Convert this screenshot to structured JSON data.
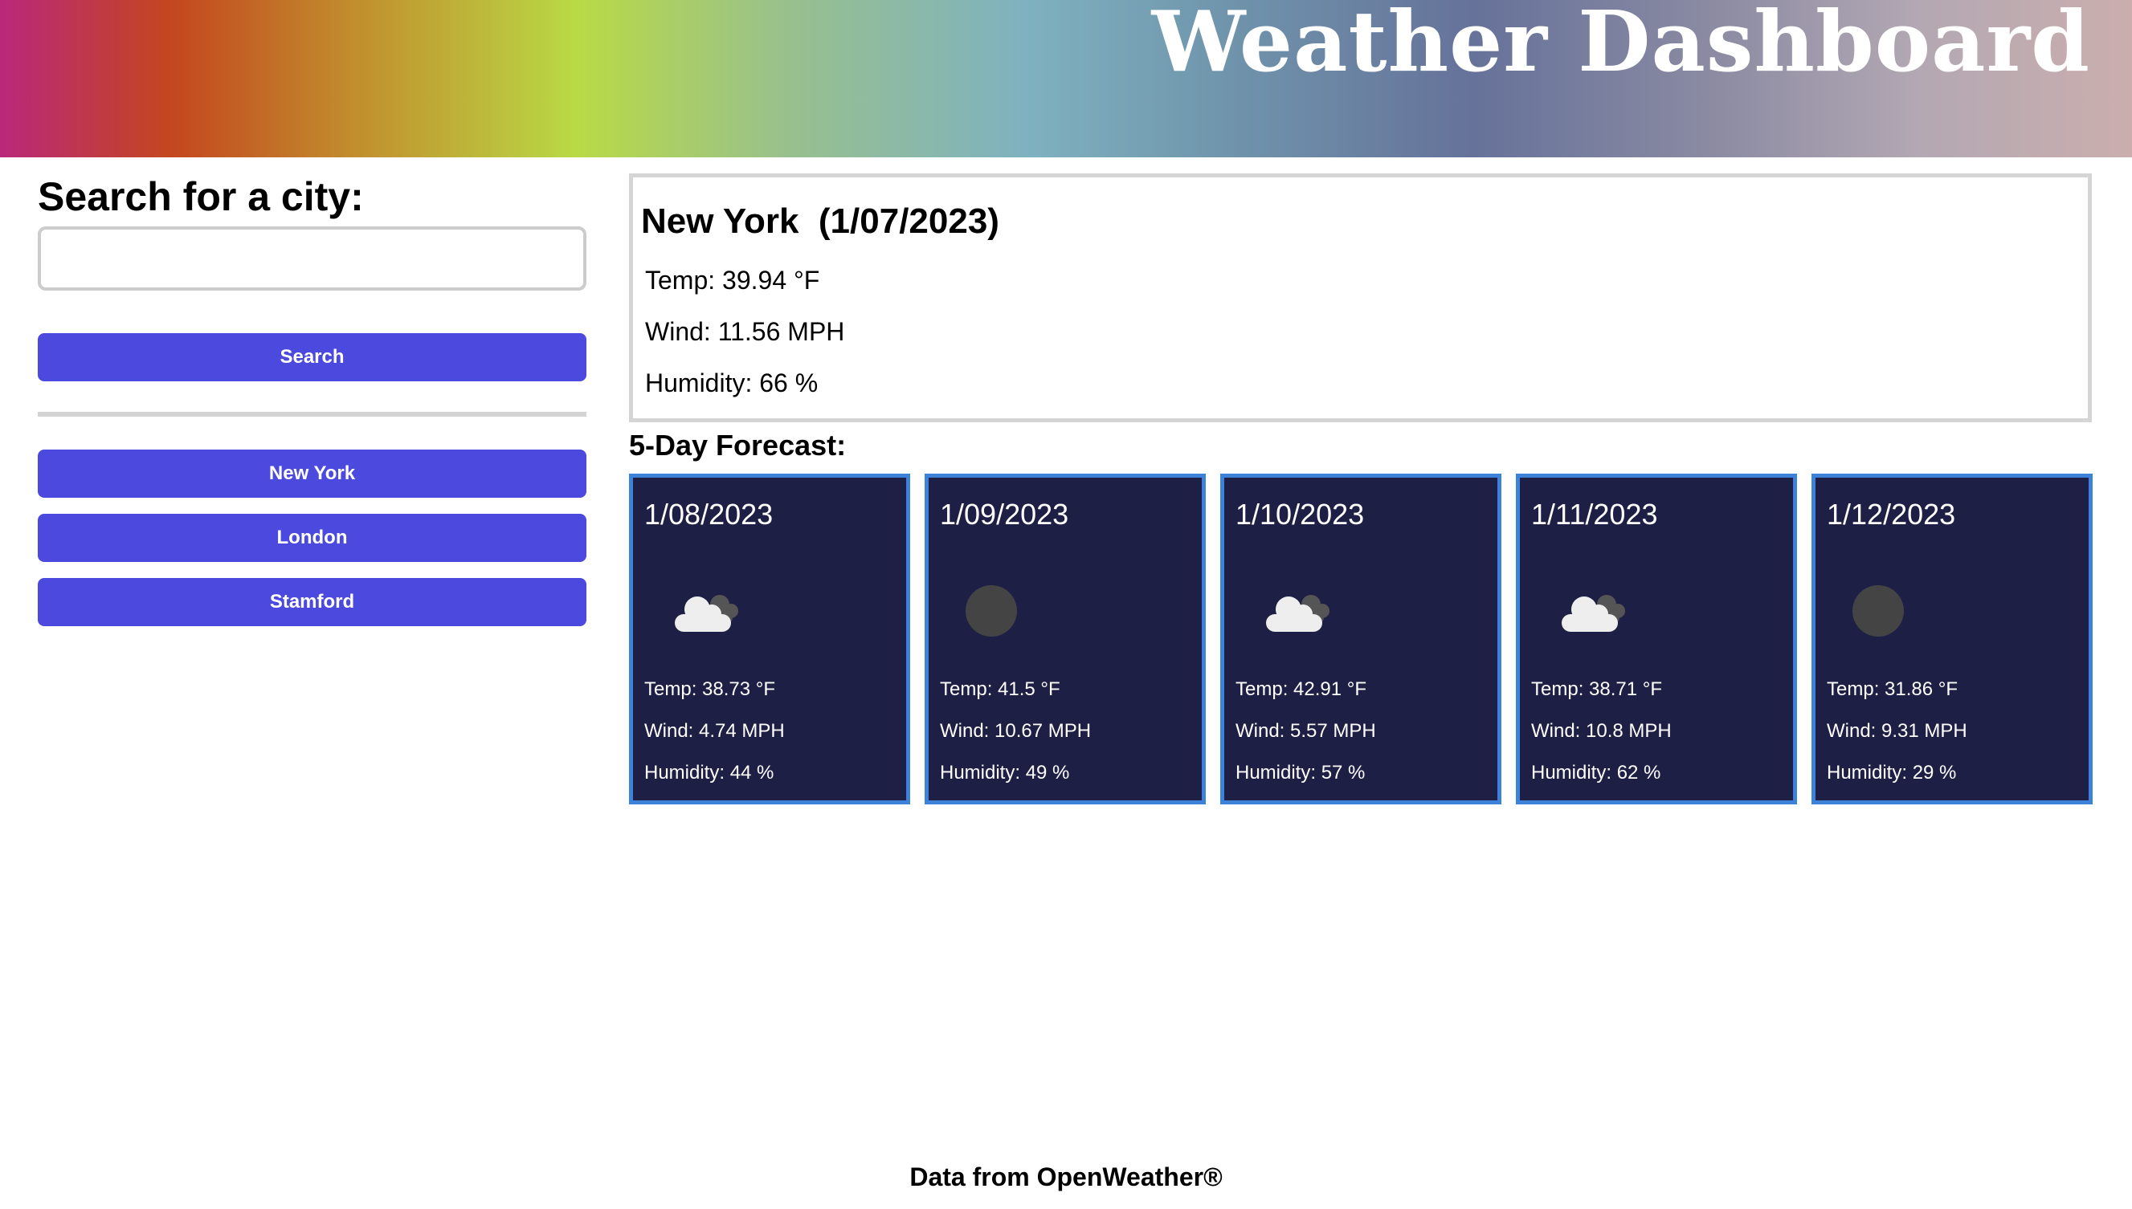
{
  "header": {
    "title": "Weather Dashboard"
  },
  "search": {
    "heading": "Search for a city:",
    "input_value": "",
    "button_label": "Search"
  },
  "history": [
    {
      "label": "New York"
    },
    {
      "label": "London"
    },
    {
      "label": "Stamford"
    }
  ],
  "current": {
    "city": "New York",
    "date": "(1/07/2023)",
    "temp": "Temp: 39.94 °F",
    "wind": "Wind: 11.56 MPH",
    "humidity": "Humidity: 66 %"
  },
  "forecast_title": "5-Day Forecast:",
  "forecast": [
    {
      "date": "1/08/2023",
      "icon": "cloud-icon",
      "temp": "Temp: 38.73 °F",
      "wind": "Wind: 4.74 MPH",
      "humidity": "Humidity: 44 %"
    },
    {
      "date": "1/09/2023",
      "icon": "moon-icon",
      "temp": "Temp: 41.5 °F",
      "wind": "Wind: 10.67 MPH",
      "humidity": "Humidity: 49 %"
    },
    {
      "date": "1/10/2023",
      "icon": "cloud-icon",
      "temp": "Temp: 42.91 °F",
      "wind": "Wind: 5.57 MPH",
      "humidity": "Humidity: 57 %"
    },
    {
      "date": "1/11/2023",
      "icon": "cloud-icon",
      "temp": "Temp: 38.71 °F",
      "wind": "Wind: 10.8 MPH",
      "humidity": "Humidity: 62 %"
    },
    {
      "date": "1/12/2023",
      "icon": "moon-icon",
      "temp": "Temp: 31.86 °F",
      "wind": "Wind: 9.31 MPH",
      "humidity": "Humidity: 29 %"
    }
  ],
  "footer": {
    "text": "Data from OpenWeather®"
  },
  "colors": {
    "accent_button": "#4b49de",
    "card_background": "#1e1f44",
    "card_border": "#3b82d8"
  }
}
